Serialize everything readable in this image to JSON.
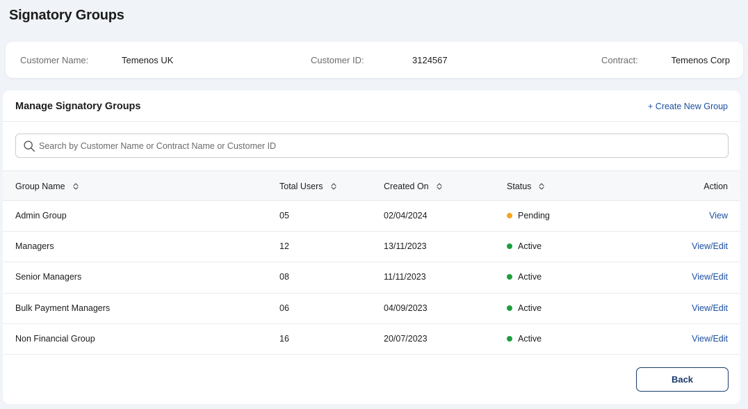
{
  "page": {
    "title": "Signatory Groups"
  },
  "customer": {
    "name_label": "Customer Name:",
    "name_value": "Temenos UK",
    "id_label": "Customer ID:",
    "id_value": "3124567",
    "contract_label": "Contract:",
    "contract_value": "Temenos Corp"
  },
  "manage": {
    "title": "Manage Signatory Groups",
    "create_link": "+ Create New Group",
    "search_placeholder": "Search by Customer Name or Contract Name or Customer ID",
    "search_value": ""
  },
  "table": {
    "headers": {
      "group_name": "Group Name",
      "total_users": "Total Users",
      "created_on": "Created On",
      "status": "Status",
      "action": "Action"
    },
    "rows": [
      {
        "group_name": "Admin Group",
        "total_users": "05",
        "created_on": "02/04/2024",
        "status": "Pending",
        "action": "View"
      },
      {
        "group_name": "Managers",
        "total_users": "12",
        "created_on": "13/11/2023",
        "status": "Active",
        "action": "View/Edit"
      },
      {
        "group_name": "Senior Managers",
        "total_users": "08",
        "created_on": "11/11/2023",
        "status": "Active",
        "action": "View/Edit"
      },
      {
        "group_name": "Bulk Payment Managers",
        "total_users": "06",
        "created_on": "04/09/2023",
        "status": "Active",
        "action": "View/Edit"
      },
      {
        "group_name": "Non Financial Group",
        "total_users": "16",
        "created_on": "20/07/2023",
        "status": "Active",
        "action": "View/Edit"
      }
    ]
  },
  "footer": {
    "back_label": "Back"
  },
  "colors": {
    "pending": "#f5a623",
    "active": "#1e9e3e",
    "link": "#1a4fa0",
    "button_border": "#1b3a6b"
  },
  "icons": {
    "search": "search-icon",
    "sort": "sort-updown-icon"
  }
}
